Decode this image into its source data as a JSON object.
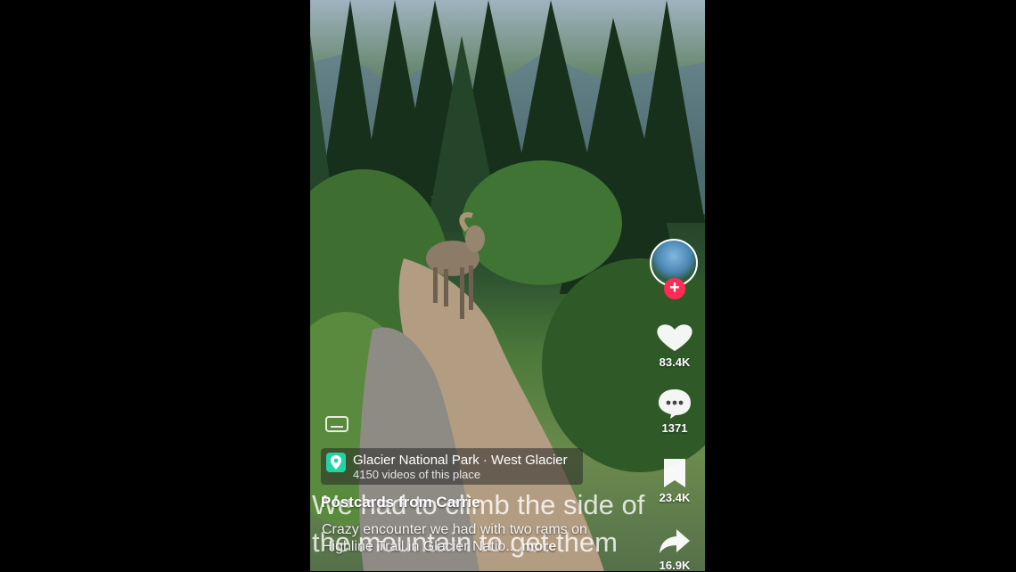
{
  "post": {
    "author": "Postcards from Carrie",
    "description": "Crazy encounter we had with two rams on Highline Trail in Glacier Natio...",
    "more_label": "more",
    "overlay_line1": "We had to climb the side of",
    "overlay_line2": "the mountain to get them"
  },
  "location": {
    "name": "Glacier National Park · West Glacier",
    "videos": "4150 videos of this place",
    "icon": "location-pin-icon"
  },
  "actions": {
    "likes": "83.4K",
    "comments": "1371",
    "saves": "23.4K",
    "shares": "16.9K"
  },
  "colors": {
    "follow_accent": "#fe2c55",
    "location_accent": "#20d5a2"
  }
}
